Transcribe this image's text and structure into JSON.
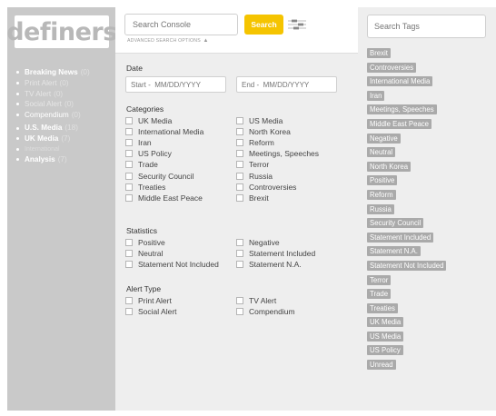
{
  "logo": "definers",
  "sidebar": {
    "items": [
      {
        "label": "Breaking News",
        "count": "(0)"
      },
      {
        "label": "Print Alert",
        "count": "(0)"
      },
      {
        "label": "TV Alert",
        "count": "(0)"
      },
      {
        "label": "Social Alert",
        "count": "(0)"
      },
      {
        "label": "Compendium",
        "count": "(0)"
      },
      {
        "label": "U.S. Media",
        "count": "(18)"
      },
      {
        "label": "UK Media",
        "count": "(7)"
      },
      {
        "label": "International",
        "count": ""
      },
      {
        "label": "Analysis",
        "count": "(7)"
      }
    ]
  },
  "search": {
    "placeholder": "Search Console",
    "button": "Search",
    "advanced": "ADVANCED SEARCH OPTIONS",
    "advanced_icon": "▲"
  },
  "date": {
    "title": "Date",
    "start_placeholder": "Start -  MM/DD/YYYY",
    "end_placeholder": "End -  MM/DD/YYYY"
  },
  "categories": {
    "title": "Categories",
    "left": [
      "UK Media",
      "International Media",
      "Iran",
      "US Policy",
      "Trade",
      "Security Council",
      "Treaties",
      "Middle East Peace"
    ],
    "right": [
      "US Media",
      "North Korea",
      "Reform",
      "Meetings, Speeches",
      "Terror",
      "Russia",
      "Controversies",
      "Brexit"
    ]
  },
  "statistics": {
    "title": "Statistics",
    "left": [
      "Positive",
      "Neutral",
      "Statement Not Included"
    ],
    "right": [
      "Negative",
      "Statement Included",
      "Statement N.A."
    ]
  },
  "alert_type": {
    "title": "Alert Type",
    "left": [
      "Print Alert",
      "Social Alert"
    ],
    "right": [
      "TV Alert",
      "Compendium"
    ]
  },
  "tags": {
    "placeholder": "Search Tags",
    "items": [
      "Brexit",
      "Controversies",
      "International Media",
      "Iran",
      "Meetings, Speeches",
      "Middle East Peace",
      "Negative",
      "Neutral",
      "North Korea",
      "Positive",
      "Reform",
      "Russia",
      "Security Council",
      "Statement Included",
      "Statement N.A.",
      "Statement Not Included",
      "Terror",
      "Trade",
      "Treaties",
      "UK Media",
      "US Media",
      "US Policy",
      "Unread"
    ]
  },
  "colors": {
    "accent": "#f5c400",
    "sidebar": "#c9c9c9",
    "panel": "#eeeeee",
    "tag": "#aaaaaa"
  }
}
